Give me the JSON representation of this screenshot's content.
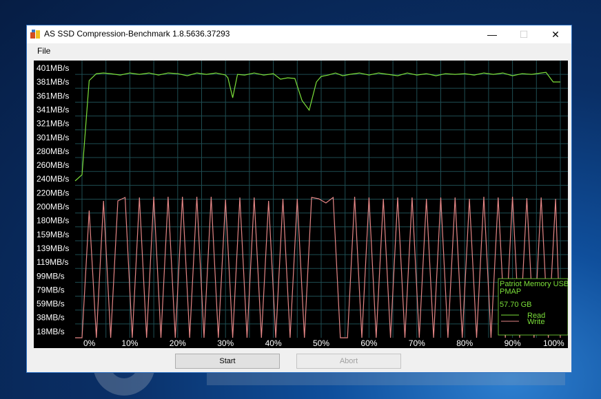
{
  "window": {
    "title": "AS SSD Compression-Benchmark 1.8.5636.37293",
    "minimize_glyph": "—",
    "maximize_glyph": "☐",
    "close_glyph": "✕"
  },
  "menu": {
    "file_label": "File"
  },
  "buttons": {
    "start_label": "Start",
    "abort_label": "Abort"
  },
  "legend": {
    "device": "Patriot Memory USB",
    "volume": "PMAP",
    "capacity": "57.70 GB",
    "read_label": "Read",
    "write_label": "Write"
  },
  "colors": {
    "read": "#7CE03A",
    "write": "#E58686",
    "grid": "#1e4d52",
    "plot_background": "#000000",
    "axis_text": "#ffffff"
  },
  "chart_data": {
    "type": "line",
    "y_ticks": [
      "401MB/s",
      "381MB/s",
      "361MB/s",
      "341MB/s",
      "321MB/s",
      "301MB/s",
      "280MB/s",
      "260MB/s",
      "240MB/s",
      "220MB/s",
      "200MB/s",
      "180MB/s",
      "159MB/s",
      "139MB/s",
      "119MB/s",
      "99MB/s",
      "79MB/s",
      "59MB/s",
      "38MB/s",
      "18MB/s"
    ],
    "x_ticks": [
      "0%",
      "10%",
      "20%",
      "30%",
      "40%",
      "50%",
      "60%",
      "70%",
      "80%",
      "90%",
      "100%"
    ],
    "xlim": [
      0,
      100
    ],
    "ylim": [
      0,
      420
    ],
    "series": [
      {
        "name": "Read",
        "x": [
          -1.5,
          0,
          1.5,
          3,
          4.5,
          6,
          8,
          10,
          12,
          14,
          16,
          18,
          20,
          22,
          24,
          26,
          28,
          30,
          30.5,
          31.5,
          32.5,
          34,
          36,
          38,
          40,
          41.5,
          43,
          44.5,
          46,
          47.5,
          49,
          50,
          51.5,
          53,
          54.5,
          56,
          58,
          60,
          62,
          64,
          66,
          68,
          70,
          72,
          74,
          76,
          78,
          80,
          82,
          84,
          86,
          88,
          90,
          92,
          94,
          96,
          97,
          98.5,
          100
        ],
        "y": [
          236,
          245,
          382,
          392,
          393,
          392,
          390,
          393,
          391,
          393,
          390,
          393,
          392,
          389,
          393,
          391,
          393,
          390,
          386,
          357,
          391,
          390,
          393,
          390,
          392,
          384,
          386,
          385,
          353,
          339,
          380,
          388,
          390,
          393,
          389,
          391,
          393,
          390,
          393,
          391,
          389,
          393,
          390,
          392,
          389,
          392,
          391,
          392,
          390,
          393,
          391,
          393,
          389,
          392,
          391,
          393,
          394,
          380,
          380
        ]
      },
      {
        "name": "Write",
        "x": [
          -1.5,
          0,
          1.5,
          3,
          4.5,
          6,
          7.5,
          9,
          10.5,
          12,
          13.5,
          15,
          16.5,
          18,
          19.5,
          21,
          22.5,
          24,
          25.5,
          27,
          28.5,
          30,
          31.5,
          33,
          34.5,
          36,
          37.5,
          39,
          40.5,
          42,
          43.5,
          45,
          46.5,
          48,
          49.5,
          51,
          52.5,
          54,
          55.5,
          57,
          58.5,
          60,
          61.5,
          63,
          64.5,
          66,
          67.5,
          69,
          70.5,
          72,
          73.5,
          75,
          76.5,
          78,
          79.5,
          81,
          82.5,
          84,
          85.5,
          87,
          88.5,
          90,
          91.5,
          93,
          94.5,
          96,
          97.5,
          99,
          100
        ],
        "y": [
          0,
          3,
          193,
          0,
          207,
          0,
          207,
          212,
          3,
          212,
          3,
          213,
          3,
          213,
          3,
          213,
          0,
          213,
          3,
          213,
          0,
          209,
          5,
          212,
          3,
          212,
          5,
          207,
          3,
          210,
          0,
          210,
          5,
          212,
          210,
          204,
          212,
          0,
          3,
          213,
          3,
          212,
          0,
          210,
          3,
          212,
          0,
          212,
          3,
          210,
          0,
          212,
          3,
          212,
          0,
          210,
          3,
          213,
          0,
          212,
          3,
          213,
          0,
          211,
          3,
          212,
          0,
          210,
          0
        ]
      }
    ]
  }
}
